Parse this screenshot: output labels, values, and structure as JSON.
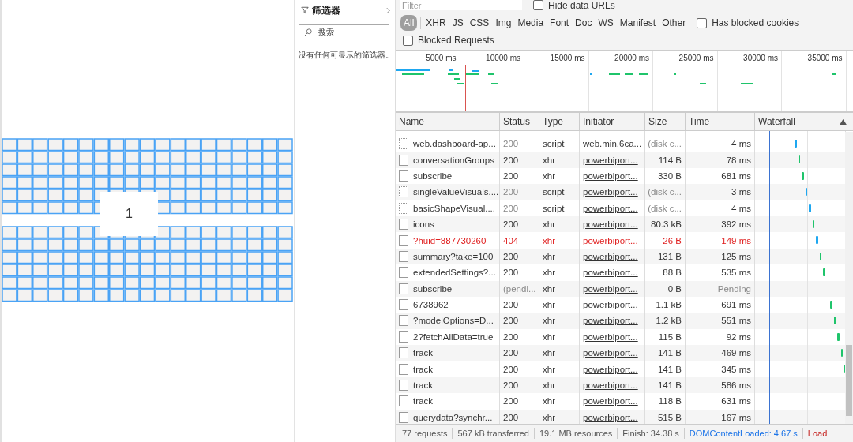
{
  "filter_pane": {
    "title": "筛选器",
    "search": {
      "placeholder": "搜索"
    },
    "message": "没有任何可显示的筛选器。"
  },
  "canvas": {
    "card_value": "1"
  },
  "devtools": {
    "filter": {
      "placeholder": "Filter"
    },
    "hide_data_urls": {
      "label": "Hide data URLs",
      "checked": false
    },
    "types": [
      {
        "label": "All",
        "selected": true
      },
      {
        "label": "XHR",
        "selected": false
      },
      {
        "label": "JS",
        "selected": false
      },
      {
        "label": "CSS",
        "selected": false
      },
      {
        "label": "Img",
        "selected": false
      },
      {
        "label": "Media",
        "selected": false
      },
      {
        "label": "Font",
        "selected": false
      },
      {
        "label": "Doc",
        "selected": false
      },
      {
        "label": "WS",
        "selected": false
      },
      {
        "label": "Manifest",
        "selected": false
      },
      {
        "label": "Other",
        "selected": false
      }
    ],
    "has_blocked_cookies": {
      "label": "Has blocked cookies",
      "checked": false
    },
    "blocked_requests": {
      "label": "Blocked Requests",
      "checked": false
    },
    "overview": {
      "ticks": [
        "5000 ms",
        "10000 ms",
        "15000 ms",
        "20000 ms",
        "25000 ms",
        "30000 ms",
        "35000 ms"
      ]
    },
    "table": {
      "columns": [
        "Name",
        "Status",
        "Type",
        "Initiator",
        "Size",
        "Time",
        "Waterfall"
      ],
      "rows": [
        {
          "name": "web.dashboard-ap...",
          "status": "200",
          "type": "script",
          "initiator": "web.min.6ca...",
          "size": "(disk c...",
          "time": "4 ms",
          "cached": true,
          "error": false,
          "pending": false
        },
        {
          "name": "conversationGroups",
          "status": "200",
          "type": "xhr",
          "initiator": "powerbiport...",
          "size": "114 B",
          "time": "78 ms",
          "cached": false,
          "error": false,
          "pending": false
        },
        {
          "name": "subscribe",
          "status": "200",
          "type": "xhr",
          "initiator": "powerbiport...",
          "size": "330 B",
          "time": "681 ms",
          "cached": false,
          "error": false,
          "pending": false
        },
        {
          "name": "singleValueVisuals....",
          "status": "200",
          "type": "script",
          "initiator": "powerbiport...",
          "size": "(disk c...",
          "time": "3 ms",
          "cached": true,
          "error": false,
          "pending": false
        },
        {
          "name": "basicShapeVisual....",
          "status": "200",
          "type": "script",
          "initiator": "powerbiport...",
          "size": "(disk c...",
          "time": "4 ms",
          "cached": true,
          "error": false,
          "pending": false
        },
        {
          "name": "icons",
          "status": "200",
          "type": "xhr",
          "initiator": "powerbiport...",
          "size": "80.3 kB",
          "time": "392 ms",
          "cached": false,
          "error": false,
          "pending": false
        },
        {
          "name": "?huid=887730260",
          "status": "404",
          "type": "xhr",
          "initiator": "powerbiport...",
          "size": "26 B",
          "time": "149 ms",
          "cached": false,
          "error": true,
          "pending": false
        },
        {
          "name": "summary?take=100",
          "status": "200",
          "type": "xhr",
          "initiator": "powerbiport...",
          "size": "131 B",
          "time": "125 ms",
          "cached": false,
          "error": false,
          "pending": false
        },
        {
          "name": "extendedSettings?...",
          "status": "200",
          "type": "xhr",
          "initiator": "powerbiport...",
          "size": "88 B",
          "time": "535 ms",
          "cached": false,
          "error": false,
          "pending": false
        },
        {
          "name": "subscribe",
          "status": "(pendi...",
          "type": "xhr",
          "initiator": "powerbiport...",
          "size": "0 B",
          "time": "Pending",
          "cached": false,
          "error": false,
          "pending": true
        },
        {
          "name": "6738962",
          "status": "200",
          "type": "xhr",
          "initiator": "powerbiport...",
          "size": "1.1 kB",
          "time": "691 ms",
          "cached": false,
          "error": false,
          "pending": false
        },
        {
          "name": "?modelOptions=D...",
          "status": "200",
          "type": "xhr",
          "initiator": "powerbiport...",
          "size": "1.2 kB",
          "time": "551 ms",
          "cached": false,
          "error": false,
          "pending": false
        },
        {
          "name": "2?fetchAllData=true",
          "status": "200",
          "type": "xhr",
          "initiator": "powerbiport...",
          "size": "115 B",
          "time": "92 ms",
          "cached": false,
          "error": false,
          "pending": false
        },
        {
          "name": "track",
          "status": "200",
          "type": "xhr",
          "initiator": "powerbiport...",
          "size": "141 B",
          "time": "469 ms",
          "cached": false,
          "error": false,
          "pending": false
        },
        {
          "name": "track",
          "status": "200",
          "type": "xhr",
          "initiator": "powerbiport...",
          "size": "141 B",
          "time": "345 ms",
          "cached": false,
          "error": false,
          "pending": false
        },
        {
          "name": "track",
          "status": "200",
          "type": "xhr",
          "initiator": "powerbiport...",
          "size": "141 B",
          "time": "586 ms",
          "cached": false,
          "error": false,
          "pending": false
        },
        {
          "name": "track",
          "status": "200",
          "type": "xhr",
          "initiator": "powerbiport...",
          "size": "118 B",
          "time": "631 ms",
          "cached": false,
          "error": false,
          "pending": false
        },
        {
          "name": "querydata?synchr...",
          "status": "200",
          "type": "xhr",
          "initiator": "powerbiport...",
          "size": "515 B",
          "time": "167 ms",
          "cached": false,
          "error": false,
          "pending": false
        }
      ]
    },
    "status_bar": [
      {
        "text": "77 requests",
        "kind": "plain"
      },
      {
        "text": "567 kB transferred",
        "kind": "plain"
      },
      {
        "text": "19.1 MB resources",
        "kind": "plain"
      },
      {
        "text": "Finish: 34.38 s",
        "kind": "plain"
      },
      {
        "text": "DOMContentLoaded: 4.67 s",
        "kind": "dom"
      },
      {
        "text": "Load",
        "kind": "load"
      }
    ]
  }
}
